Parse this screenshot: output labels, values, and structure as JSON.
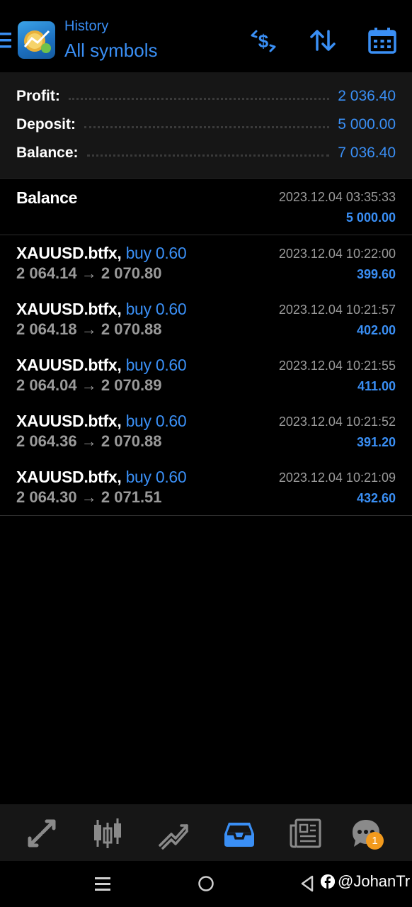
{
  "header": {
    "subtitle": "History",
    "title": "All symbols",
    "icons": [
      "menu-icon",
      "app-logo",
      "deposit-withdraw-icon",
      "sort-icon",
      "calendar-icon"
    ]
  },
  "summary": {
    "profit_label": "Profit:",
    "profit_value": "2 036.40",
    "deposit_label": "Deposit:",
    "deposit_value": "5 000.00",
    "balance_label": "Balance:",
    "balance_value": "7 036.40"
  },
  "balance_entry": {
    "title": "Balance",
    "time": "2023.12.04 03:35:33",
    "amount": "5 000.00"
  },
  "deals": [
    {
      "symbol": "XAUUSD.btfx,",
      "type": "buy 0.60",
      "open": "2 064.14",
      "arrow": "→",
      "close": "2 070.80",
      "time": "2023.12.04 10:22:00",
      "profit": "399.60"
    },
    {
      "symbol": "XAUUSD.btfx,",
      "type": "buy 0.60",
      "open": "2 064.18",
      "arrow": "→",
      "close": "2 070.88",
      "time": "2023.12.04 10:21:57",
      "profit": "402.00"
    },
    {
      "symbol": "XAUUSD.btfx,",
      "type": "buy 0.60",
      "open": "2 064.04",
      "arrow": "→",
      "close": "2 070.89",
      "time": "2023.12.04 10:21:55",
      "profit": "411.00"
    },
    {
      "symbol": "XAUUSD.btfx,",
      "type": "buy 0.60",
      "open": "2 064.36",
      "arrow": "→",
      "close": "2 070.88",
      "time": "2023.12.04 10:21:52",
      "profit": "391.20"
    },
    {
      "symbol": "XAUUSD.btfx,",
      "type": "buy 0.60",
      "open": "2 064.30",
      "arrow": "→",
      "close": "2 071.51",
      "time": "2023.12.04 10:21:09",
      "profit": "432.60"
    }
  ],
  "tabs": [
    {
      "name": "quotes-icon",
      "active": false
    },
    {
      "name": "chart-icon",
      "active": false
    },
    {
      "name": "trade-icon",
      "active": false
    },
    {
      "name": "history-icon",
      "active": true
    },
    {
      "name": "news-icon",
      "active": false
    },
    {
      "name": "messages-icon",
      "active": false
    }
  ],
  "messages_badge": "1",
  "watermark": "@JohanTr",
  "colors": {
    "accent": "#3a8ff5",
    "muted": "#9a9a9a",
    "panel": "#161616",
    "badge": "#f29a1d"
  }
}
